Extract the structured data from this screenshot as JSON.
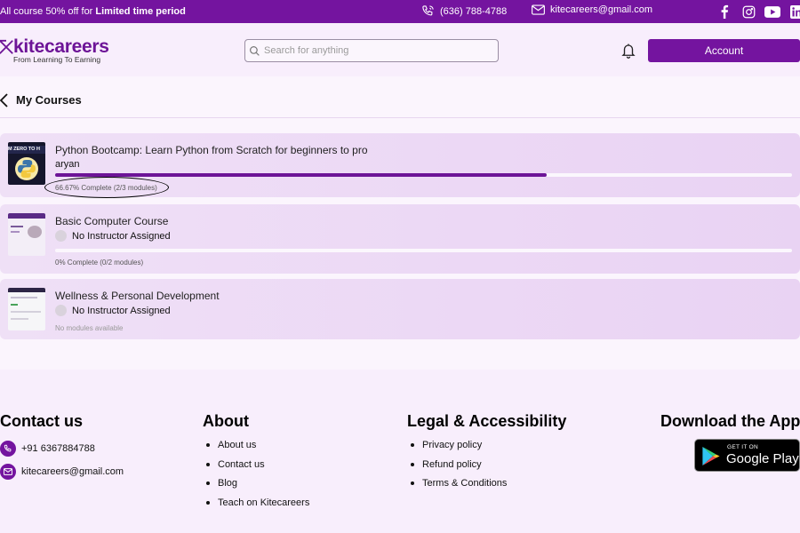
{
  "topbar": {
    "promo_prefix": "All course 50% off for ",
    "promo_highlight": "Limited time period",
    "phone": "(636) 788-4788",
    "email": "kitecareers@gmail.com",
    "socials": [
      "facebook-icon",
      "instagram-icon",
      "youtube-icon",
      "linkedin-icon"
    ],
    "bg_color": "#74149f"
  },
  "header": {
    "brand": "kitecareers",
    "tagline": "From Learning To Earning",
    "search_placeholder": "Search for anything",
    "account_label": "Account"
  },
  "page": {
    "title": "My Courses"
  },
  "courses": [
    {
      "title": "Python Bootcamp: Learn Python from Scratch for beginners to pro",
      "instructor": "aryan",
      "progress": 0.6667,
      "status": "66.67% Complete (2/3 modules)",
      "thumb_text": "M ZERO TO H"
    },
    {
      "title": "Basic Computer Course",
      "instructor": "No Instructor Assigned",
      "progress": 0,
      "status": "0% Complete (0/2 modules)"
    },
    {
      "title": "Wellness & Personal Development",
      "instructor": "No Instructor Assigned",
      "progress": null,
      "status": "No modules available"
    }
  ],
  "footer": {
    "contact": {
      "heading": "Contact us",
      "phone": "+91 6367884788",
      "email": "kitecareers@gmail.com"
    },
    "about": {
      "heading": "About",
      "links": [
        "About us",
        "Contact us",
        "Blog",
        "Teach on Kitecareers"
      ]
    },
    "legal": {
      "heading": "Legal & Accessibility",
      "links": [
        "Privacy policy",
        "Refund policy",
        "Terms & Conditions"
      ]
    },
    "app": {
      "heading": "Download the App",
      "badge_small": "GET IT ON",
      "badge_big": "Google Play"
    }
  },
  "colors": {
    "primary": "#74149f",
    "progress": "#6d1497",
    "card_bg": "#ecd8f5"
  }
}
